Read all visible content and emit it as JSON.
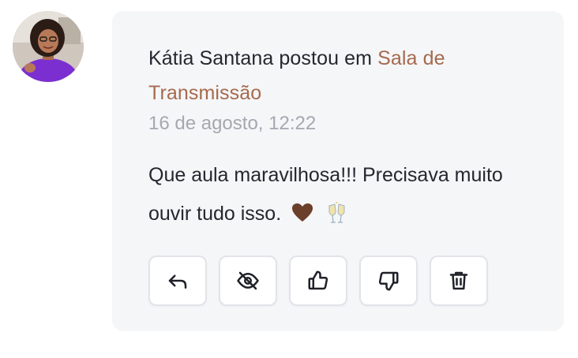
{
  "post": {
    "author": "Kátia Santana",
    "action_text": " postou em ",
    "room": "Sala de Transmissão",
    "timestamp": "16 de agosto, 12:22",
    "message": "Que aula maravilhosa!!! Precisava muito ouvir tudo isso."
  },
  "actions": [
    {
      "icon": "reply-icon"
    },
    {
      "icon": "eye-off-icon"
    },
    {
      "icon": "thumbs-up-icon"
    },
    {
      "icon": "thumbs-down-icon"
    },
    {
      "icon": "trash-icon"
    }
  ],
  "colors": {
    "card_background": "#f5f6f8",
    "link": "#a66a4d",
    "text": "#24272e",
    "muted": "#a5a8b0",
    "button_border": "#e2e4e9"
  }
}
